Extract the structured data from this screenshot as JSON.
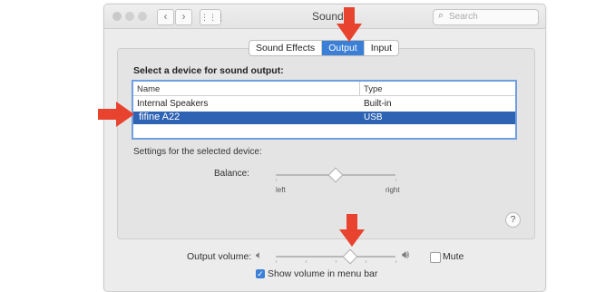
{
  "window": {
    "title": "Sound",
    "search_placeholder": "Search"
  },
  "tabs": [
    {
      "label": "Sound Effects",
      "active": false
    },
    {
      "label": "Output",
      "active": true
    },
    {
      "label": "Input",
      "active": false
    }
  ],
  "output": {
    "select_label": "Select a device for sound output:",
    "columns": {
      "name": "Name",
      "type": "Type"
    },
    "devices": [
      {
        "name": "Internal Speakers",
        "type": "Built-in",
        "selected": false
      },
      {
        "name": "fifine A22",
        "type": "USB",
        "selected": true
      }
    ],
    "settings_label": "Settings for the selected device:",
    "balance_label": "Balance:",
    "balance_left": "left",
    "balance_right": "right",
    "balance_value": 0.5
  },
  "footer": {
    "output_volume_label": "Output volume:",
    "volume_value": 0.62,
    "mute_label": "Mute",
    "mute_checked": false,
    "show_volume_label": "Show volume in menu bar",
    "show_volume_checked": true
  },
  "annotations": {
    "arrow_color": "#e8432e"
  },
  "colors": {
    "accent": "#3b7fd6",
    "selected_row": "#2e63b4"
  }
}
